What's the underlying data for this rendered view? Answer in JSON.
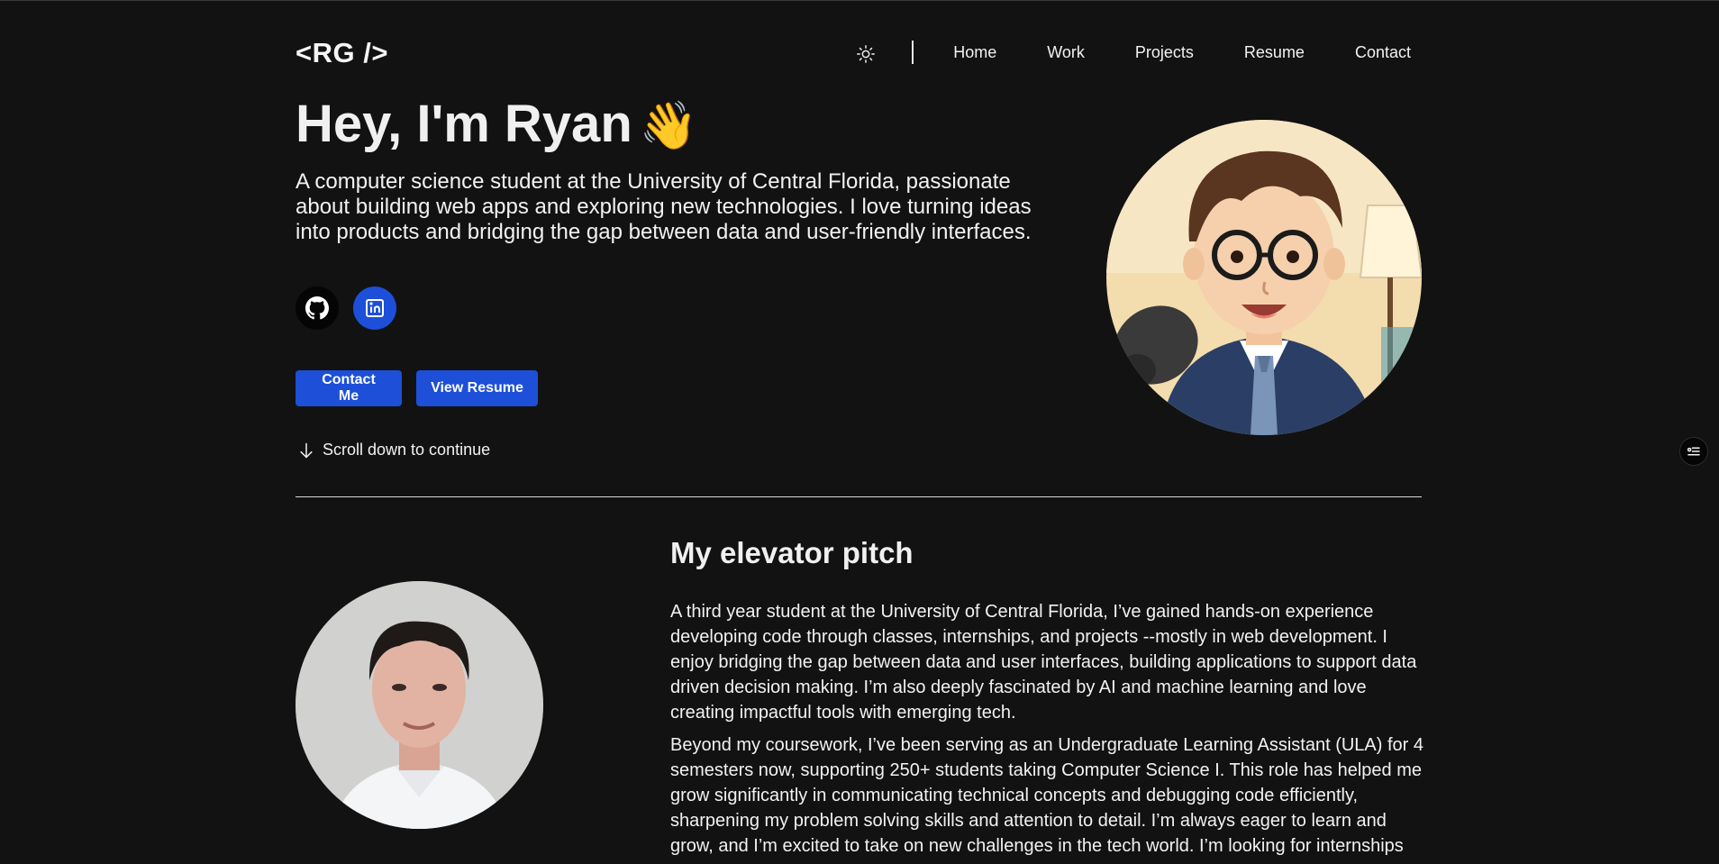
{
  "header": {
    "logo": "<RG />",
    "theme_toggle_icon": "sun-icon",
    "nav": [
      "Home",
      "Work",
      "Projects",
      "Resume",
      "Contact"
    ]
  },
  "hero": {
    "title": "Hey, I'm Ryan",
    "wave": "👋",
    "description": "A computer science student at the University of Central Florida, passionate about building web apps and exploring new technologies. I love turning ideas into products and bridging the gap between data and user-friendly interfaces.",
    "social": {
      "github_icon": "github-icon",
      "linkedin_icon": "linkedin-icon"
    },
    "buttons": {
      "contact": "Contact Me",
      "resume": "View Resume"
    },
    "scroll_hint": "Scroll down to continue"
  },
  "pitch": {
    "title": "My elevator pitch",
    "paragraphs": [
      "A third year student at the University of Central Florida, I’ve gained hands-on experience developing code through classes, internships, and projects --mostly in web development. I enjoy bridging the gap between data and user interfaces, building applications to support data driven decision making. I’m also deeply fascinated by AI and machine learning and love creating impactful tools with emerging tech.",
      "Beyond my coursework, I’ve been serving as an Undergraduate Learning Assistant (ULA) for 4 semesters now, supporting 250+ students taking Computer Science I. This role has helped me grow significantly in communicating technical concepts and debugging code efficiently, sharpening my problem solving skills and attention to detail. I’m always eager to learn and grow, and I’m excited to take on new challenges in the tech world. I’m looking for internships"
    ]
  },
  "colors": {
    "background": "#121212",
    "accent": "#1d4fd8",
    "text": "#f2f2f2"
  }
}
